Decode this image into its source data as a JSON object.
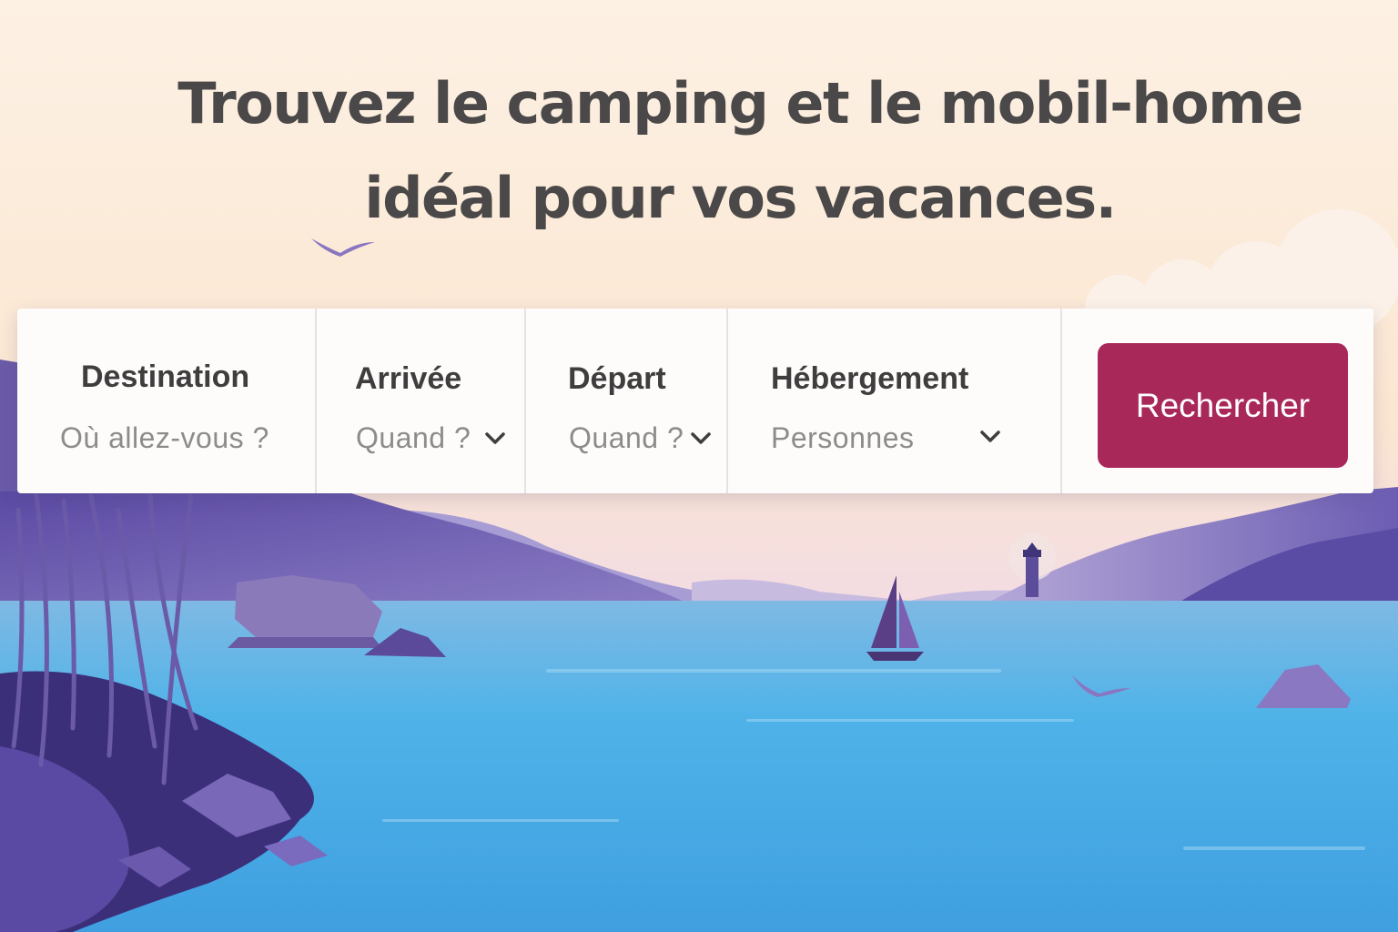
{
  "hero": {
    "title_line1": "Trouvez le camping et le mobil-home",
    "title_line2": "idéal pour vos vacances."
  },
  "search": {
    "destination": {
      "label": "Destination",
      "placeholder": "Où allez-vous ?"
    },
    "arrival": {
      "label": "Arrivée",
      "placeholder": "Quand ?",
      "icon": "chevron-down-icon"
    },
    "departure": {
      "label": "Départ",
      "placeholder": "Quand ?",
      "icon": "chevron-down-icon"
    },
    "accommodation": {
      "label": "Hébergement",
      "placeholder": "Personnes",
      "icon": "chevron-down-icon"
    },
    "submit_label": "Rechercher"
  },
  "colors": {
    "accent": "#a8285a",
    "heading": "#4a4848",
    "sky": "#fbe9d6",
    "water": "#4fb6e6",
    "hills": "#6f5fb0"
  }
}
